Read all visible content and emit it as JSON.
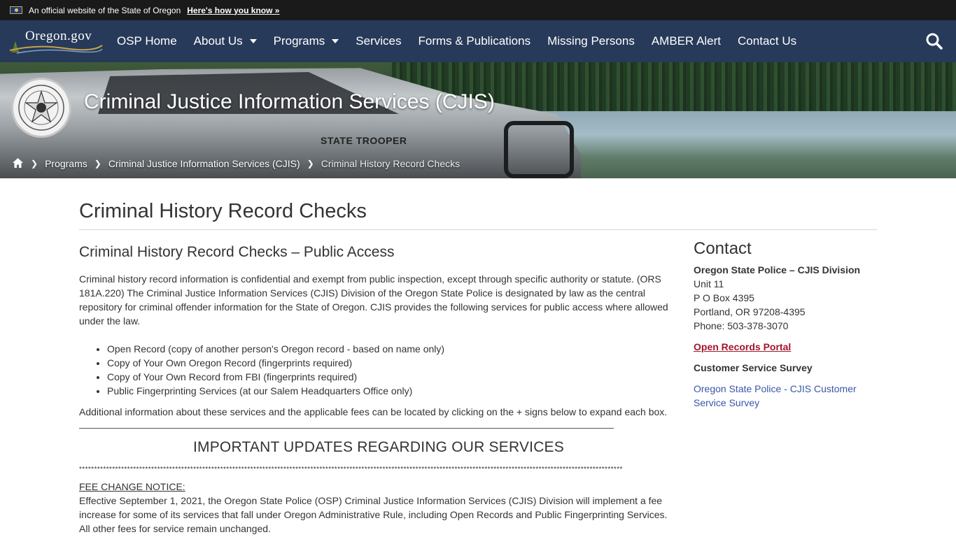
{
  "banner": {
    "official_text": "An official website of the State of Oregon",
    "how_know_link": "Here's how you know »"
  },
  "nav": {
    "logo_text": "Oregon.gov",
    "items": [
      {
        "label": "OSP Home",
        "dropdown": false
      },
      {
        "label": "About Us",
        "dropdown": true
      },
      {
        "label": "Programs",
        "dropdown": true
      },
      {
        "label": "Services",
        "dropdown": false
      },
      {
        "label": "Forms & Publications",
        "dropdown": false
      },
      {
        "label": "Missing Persons",
        "dropdown": false
      },
      {
        "label": "AMBER Alert",
        "dropdown": false
      },
      {
        "label": "Contact Us",
        "dropdown": false
      }
    ],
    "search_icon": "search-icon"
  },
  "hero": {
    "title": "Criminal Justice Information Services (CJIS)",
    "vehicle_text": "STATE TROOPER"
  },
  "breadcrumb": {
    "home_icon": "home-icon",
    "items": [
      "Programs",
      "Criminal Justice Information Services (CJIS)"
    ],
    "current": "Criminal History Record Checks"
  },
  "page": {
    "title": "Criminal History Record Checks"
  },
  "main": {
    "heading": "Criminal History Record Checks – Public Access",
    "intro": "Criminal history record information is confidential and exempt from public inspection, except through specific authority or statute.  (ORS 181A.220) The Criminal Justice Information Services (CJIS) Division of the Oregon State Police is designated by law as the central repository for criminal offender information for the State of Oregon.   CJIS provides the following services for public access where allowed under the law.",
    "services": [
      "Open Record (copy of another person's Oregon record - based on name only)",
      "Copy of Your Own Oregon Record (fingerprints required)",
      "Copy of Your Own Record from FBI (fingerprints required)",
      "Public Fingerprinting Services (at our Salem Headquarters Office only)"
    ],
    "additional": "Additional information about these services and the applicable fees can be located by clicking on the + signs below to expand each box.",
    "updates_heading": "IMPORTANT UPDATES REGARDING OUR SERVICES",
    "stars": "*************************************************************************************************************************************************************************************",
    "fee_heading": "FEE CHANGE NOTICE:",
    "fee_text": "Effective September 1, 2021, the Oregon State Police (OSP) Criminal Justice Information Services (CJIS) Division will implement a fee increase for some of its services that fall under Oregon Administrative Rule, including Open Records and Public Fingerprinting Services. All other fees for service remain unchanged."
  },
  "contact": {
    "heading": "Contact",
    "org": "Oregon State Police – CJIS Division",
    "lines": [
      "Unit 11",
      "P O Box 4395",
      "Portland, OR 97208-4395",
      "Phone: 503-378-3070"
    ],
    "portal_link": "Open Records Portal",
    "survey_title": "Customer Service Survey",
    "survey_link": "Oregon State Police - CJIS Customer Service Survey"
  },
  "colors": {
    "nav_bg": "#273a59",
    "banner_bg": "#1a1a1a",
    "portal_link": "#a2152b",
    "survey_link": "#3a57a6"
  }
}
